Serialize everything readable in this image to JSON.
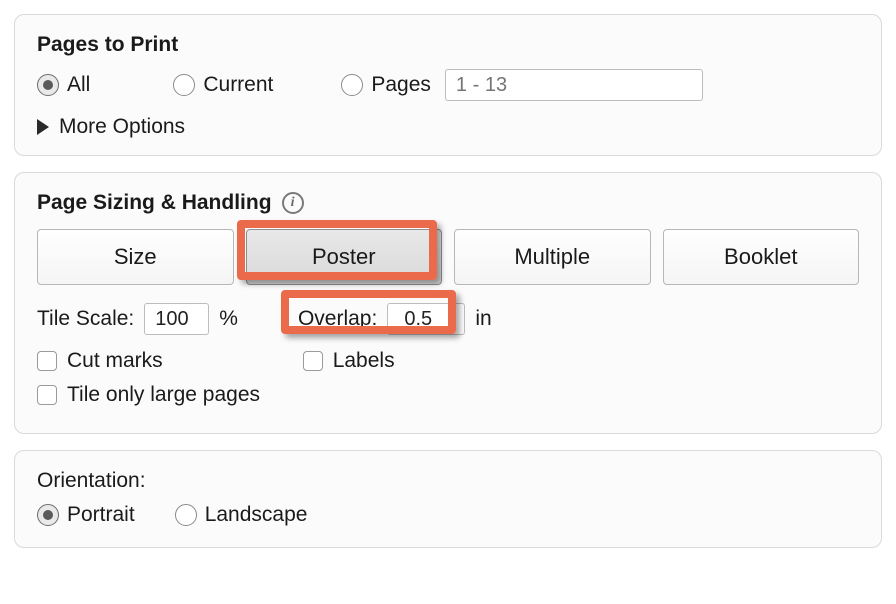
{
  "pagesPanel": {
    "title": "Pages to Print",
    "options": {
      "all": "All",
      "current": "Current",
      "pages": "Pages"
    },
    "pagesPlaceholder": "1 - 13",
    "moreOptions": "More Options"
  },
  "sizingPanel": {
    "title": "Page Sizing & Handling",
    "tabs": {
      "size": "Size",
      "poster": "Poster",
      "multiple": "Multiple",
      "booklet": "Booklet"
    },
    "tileScaleLabel": "Tile Scale:",
    "tileScaleValue": "100",
    "tileScaleUnit": "%",
    "overlapLabel": "Overlap:",
    "overlapValue": "0.5",
    "overlapUnit": "in",
    "cutMarks": "Cut marks",
    "labels": "Labels",
    "tileOnlyLarge": "Tile only large pages"
  },
  "orientationPanel": {
    "title": "Orientation:",
    "portrait": "Portrait",
    "landscape": "Landscape"
  },
  "highlightColor": "#ec6a4c"
}
